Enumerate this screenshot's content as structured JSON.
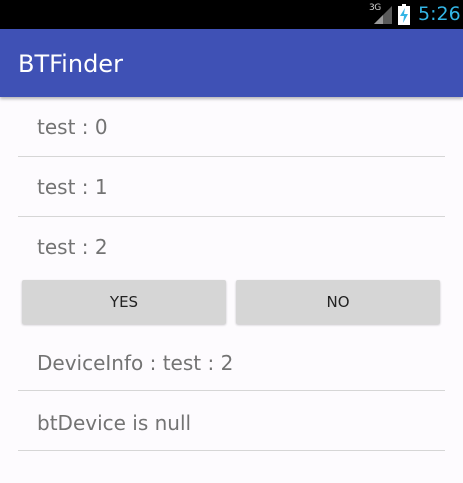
{
  "status_bar": {
    "network": "3G",
    "time": "5:26",
    "time_color": "#33b5e5"
  },
  "app_bar": {
    "title": "BTFinder",
    "color": "#3f51b5"
  },
  "device_list": [
    {
      "label": "test : 0"
    },
    {
      "label": "test : 1"
    },
    {
      "label": "test : 2"
    }
  ],
  "buttons": {
    "yes_label": "YES",
    "no_label": "NO"
  },
  "info": {
    "device_info": "DeviceInfo : test : 2",
    "bt_device": "btDevice is null"
  }
}
